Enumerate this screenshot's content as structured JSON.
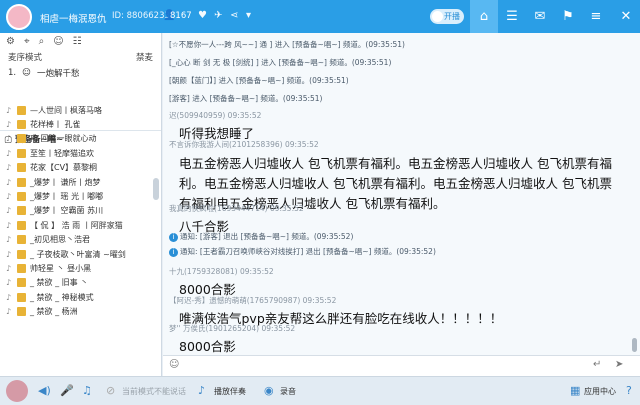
{
  "titlebar": {
    "room_name": "相虐一梅泯恩仇",
    "room_id": "ID: 88066233",
    "fans": "8167",
    "toggle_label": "开播",
    "nav_icons": [
      "home-icon",
      "chat-icon",
      "message-icon",
      "game-icon",
      "menu-icon"
    ]
  },
  "left": {
    "mode_label": "麦序模式",
    "mode_right": "禁麦",
    "queue_no": "1.",
    "queue_name": "一炮解千愁",
    "channel": "预备备~唱~",
    "members": [
      {
        "name": "—人世间丨枫落马咯"
      },
      {
        "name": "花样棒丨 孔雀"
      },
      {
        "name": "冉 回眸一眼就心动"
      },
      {
        "name": "至笙丨轻摩猫追欢"
      },
      {
        "name": "花家【CV】慕黎桐"
      },
      {
        "name": "_爆梦丨 谦所丨炮梦"
      },
      {
        "name": "_爆梦丨 瑶 光丨嘟嘟"
      },
      {
        "name": "_爆梦丨 空霸菌 苏川"
      },
      {
        "name": "【 侃 】 浩 雨 丨阿胖家猫"
      },
      {
        "name": "_初见相思丶浩君"
      },
      {
        "name": "_ 子夜枝歌丶叶富清 ~曜剑"
      },
      {
        "name": "帅轻星 丶 昼小黑"
      },
      {
        "name": "_ 禁欲 _ 旧事 丶"
      },
      {
        "name": "_ 禁欲 _ 神秘模式"
      },
      {
        "name": "_ 禁欲 _ 杨洲"
      }
    ]
  },
  "chat": {
    "lines": [
      {
        "kind": "sys",
        "text": "[☆不愿你一人---跨 风~~] 通 ] 进入 [预备备~唱~] 频道。(09:35:51)"
      },
      {
        "kind": "sys",
        "text": "[_心心 断 剑 无 极 [剑统] ] 进入 [预备备~唱~] 频道。(09:35:51)"
      },
      {
        "kind": "sys",
        "text": "[朝颜【蓝门】] 进入 [预备备~唱~] 频道。(09:35:51)"
      },
      {
        "kind": "sys",
        "text": "[游客] 进入 [预备备~唱~] 频道。(09:35:51)"
      },
      {
        "kind": "meta",
        "text": "迟(509940959) 09:35:52"
      },
      {
        "kind": "big",
        "text": "听得我想睡了"
      },
      {
        "kind": "meta",
        "text": "不言诉你我游人间(2101258396) 09:35:52"
      },
      {
        "kind": "big",
        "text": "电五金榜恶人归墟收人  包飞机票有福利。电五金榜恶人归墟收人  包飞机票有福"
      },
      {
        "kind": "big",
        "text": "利。电五金榜恶人归墟收人  包飞机票有福利。电五金榜恶人归墟收人  包飞机票"
      },
      {
        "kind": "big",
        "text": "有福利电五金榜恶人归墟收人  包飞机票有福利。"
      },
      {
        "kind": "meta",
        "text": "我真的快疯啦(1693444714) 09:35:52"
      },
      {
        "kind": "big",
        "text": "八千合影"
      },
      {
        "kind": "note",
        "text": "通知:  [游客] 退出 [预备备~唱~] 频道。(09:35:52)"
      },
      {
        "kind": "note",
        "text": "通知:  [王者霸刀召唤师峡谷对线挨打] 退出 [预备备~唱~] 频道。(09:35:52)"
      },
      {
        "kind": "meta",
        "text": "十九(1759328081) 09:35:52"
      },
      {
        "kind": "big",
        "text": "8000合影"
      },
      {
        "kind": "meta",
        "text": "【阿迟-秀】遗憾的萌萌(1765790987) 09:35:52"
      },
      {
        "kind": "big",
        "text": "唯满侠浩气pvp亲友帮这么胖还有脸吃在线收人！！！！！"
      },
      {
        "kind": "meta",
        "text": "梦'' 万俟氏(1901265204) 09:35:52"
      },
      {
        "kind": "big",
        "text": "8000合影"
      }
    ]
  },
  "bottom": {
    "mode_hint": "当前模式不能说话",
    "play_label": "播放伴奏",
    "record_label": "录音",
    "app_center": "应用中心"
  },
  "colors": {
    "accent": "#2a9ee6",
    "notice": "#2a8fd6"
  }
}
